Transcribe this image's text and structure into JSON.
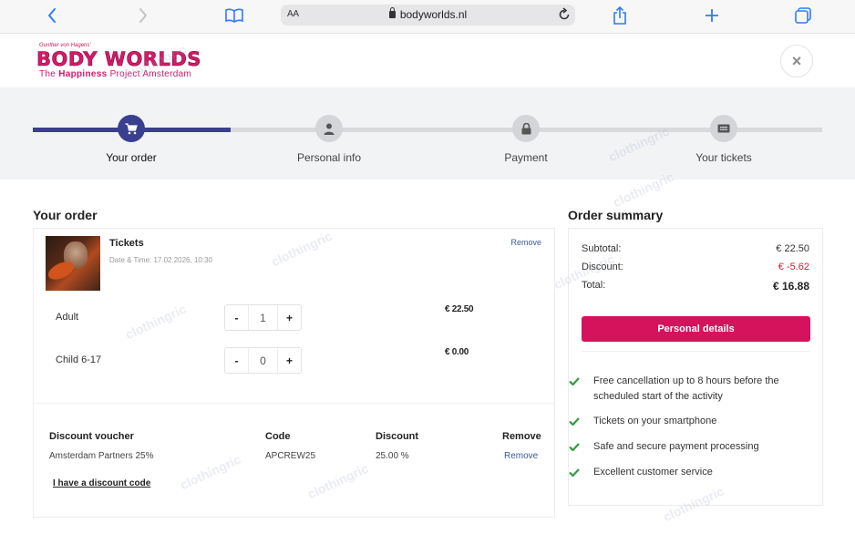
{
  "browser": {
    "text_size_label": "AA",
    "url": "bodyworlds.nl",
    "icons": [
      "back-icon",
      "forward-icon",
      "bookmarks-icon",
      "lock-icon",
      "reload-icon",
      "share-icon",
      "new-tab-icon",
      "tabs-icon"
    ]
  },
  "header": {
    "logo_top": "Gunther von Hagens'",
    "logo_main": "BODY WORLDS",
    "logo_sub_pre": "The ",
    "logo_sub_bold": "Happiness",
    "logo_sub_post": " Project Amsterdam",
    "close_label": "×"
  },
  "steps": {
    "progress_fraction": 0.25,
    "items": [
      {
        "label": "Your order",
        "icon": "cart-icon",
        "active": true
      },
      {
        "label": "Personal info",
        "icon": "person-icon",
        "active": false
      },
      {
        "label": "Payment",
        "icon": "lock-icon",
        "active": false
      },
      {
        "label": "Your tickets",
        "icon": "ticket-icon",
        "active": false
      }
    ]
  },
  "order": {
    "title": "Your order",
    "tickets_title": "Tickets",
    "date_line": "Date & Time: 17.02.2026, 10:30",
    "remove_label": "Remove",
    "rows": [
      {
        "label": "Adult",
        "minus": "-",
        "qty": "1",
        "plus": "+",
        "price": "€ 22.50"
      },
      {
        "label": "Child 6-17",
        "minus": "-",
        "qty": "0",
        "plus": "+",
        "price": "€ 0.00"
      }
    ],
    "discount": {
      "headers": [
        "Discount voucher",
        "Code",
        "Discount",
        "Remove"
      ],
      "row": [
        "Amsterdam Partners 25%",
        "APCREW25",
        "25.00 %",
        "Remove"
      ]
    },
    "have_code": "I have a discount code"
  },
  "summary": {
    "title": "Order summary",
    "subtotal_label": "Subtotal:",
    "subtotal": "€ 22.50",
    "discount_label": "Discount:",
    "discount": "€ -5.62",
    "total_label": "Total:",
    "total": "€ 16.88",
    "cta": "Personal details",
    "benefits": [
      "Free cancellation up to 8 hours before the scheduled start of the activity",
      "Tickets on your smartphone",
      "Safe and secure payment processing",
      "Excellent customer service"
    ]
  },
  "watermark": "clothingric",
  "colors": {
    "brand": "#d6196a",
    "progress": "#3a3f8f",
    "cta": "#d5135c",
    "check": "#2e9e3f",
    "link": "#3a5a9a",
    "discount_red": "#d0203a"
  }
}
